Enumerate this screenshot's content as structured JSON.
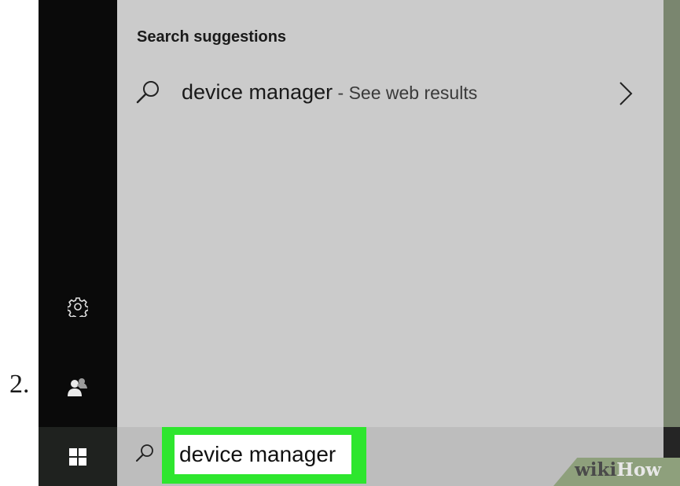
{
  "step": {
    "number": "2."
  },
  "search_panel": {
    "section_header": "Search suggestions",
    "suggestion": {
      "query": "device manager",
      "suffix": " - See web results",
      "icon": "search-icon",
      "action_icon": "chevron-right-icon"
    }
  },
  "left_rail": {
    "items": [
      {
        "icon": "gear-icon"
      },
      {
        "icon": "user-accounts-icon"
      }
    ],
    "start_icon": "windows-logo-icon"
  },
  "taskbar": {
    "search": {
      "icon": "search-icon",
      "value": "device manager"
    }
  },
  "colors": {
    "highlight": "#2ee62e",
    "panel": "#cbcbcb",
    "rail": "#0a0a0a",
    "taskbar": "#bdbdbd"
  },
  "watermark": {
    "brand": "wikiHow",
    "part1": "wiki",
    "part2": "How"
  }
}
